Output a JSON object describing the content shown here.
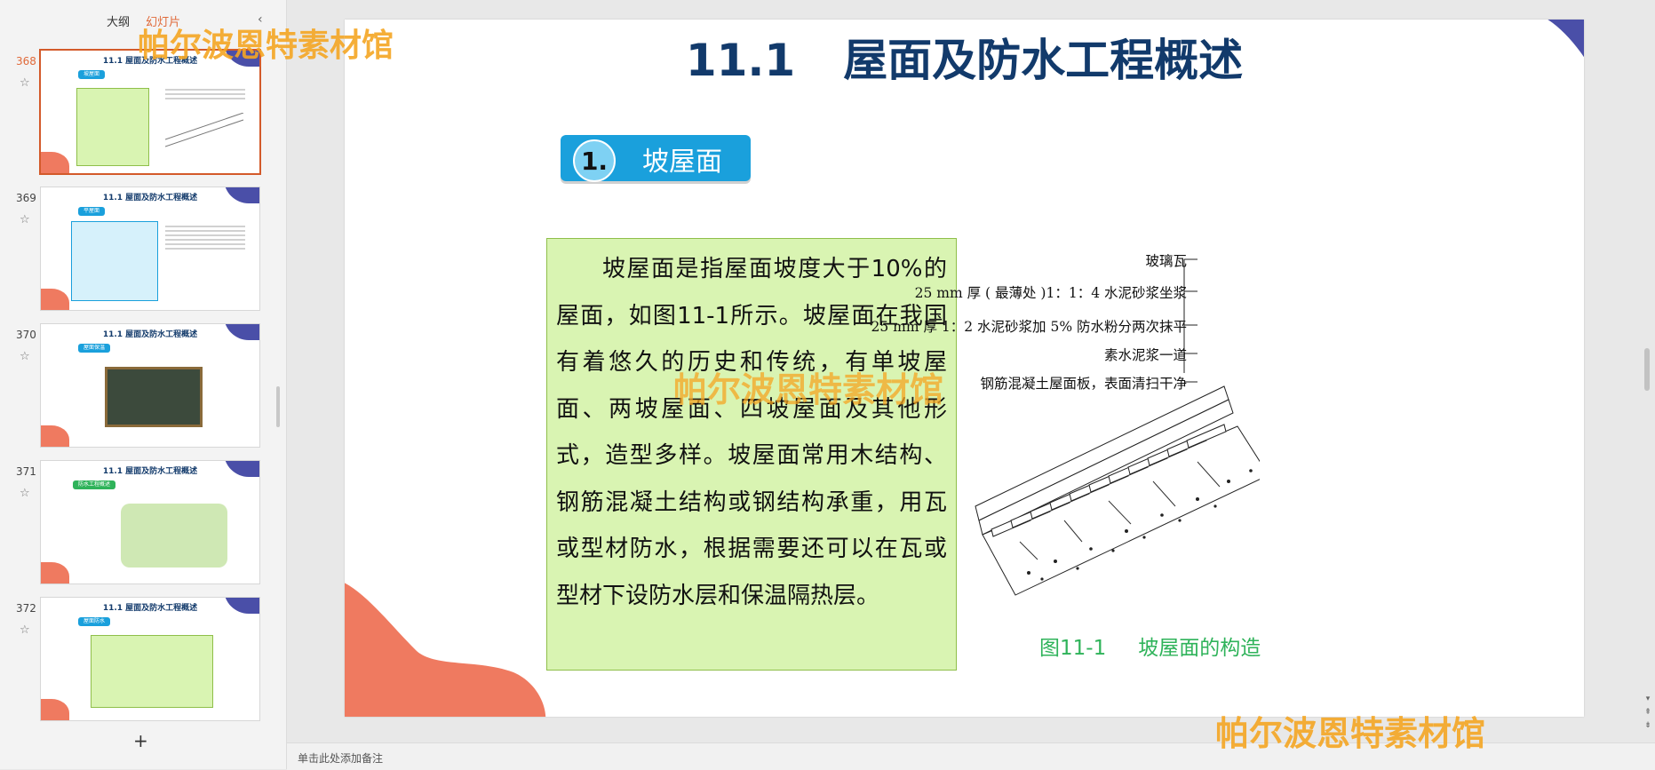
{
  "panel": {
    "tabs": [
      "大纲",
      "幻灯片"
    ],
    "active_tab": "幻灯片",
    "add_label": "+",
    "thumbnails": [
      {
        "num": "368",
        "title": "11.1    屋面及防水工程概述",
        "badge": "坡屋面"
      },
      {
        "num": "369",
        "title": "11.1    屋面及防水工程概述",
        "badge": "平屋面"
      },
      {
        "num": "370",
        "title": "11.1    屋面及防水工程概述",
        "badge": "屋面保温"
      },
      {
        "num": "371",
        "title": "11.1    屋面及防水工程概述",
        "badge": "防水工程概述"
      },
      {
        "num": "372",
        "title": "11.1    屋面及防水工程概述",
        "badge": "屋面防水"
      }
    ]
  },
  "slide": {
    "title_num": "11.1",
    "title_text": "屋面及防水工程概述",
    "section_number": "1.",
    "section_label": "坡屋面",
    "body": "坡屋面是指屋面坡度大于10%的屋面，如图11-1所示。坡屋面在我国有着悠久的历史和传统，有单坡屋面、两坡屋面、四坡屋面及其他形式，造型多样。坡屋面常用木结构、钢筋混凝土结构或钢结构承重，用瓦或型材防水，根据需要还可以在瓦或型材下设防水层和保温隔热层。",
    "figure_labels": [
      "玻璃瓦",
      "25 mm 厚 ( 最薄处 )1：1：4 水泥砂浆坐浆",
      "25 mm 厚 1：2 水泥砂浆加 5% 防水粉分两次抹平",
      "素水泥浆一道",
      "钢筋混凝土屋面板，表面清扫干净"
    ],
    "caption_num": "图11-1",
    "caption_text": "坡屋面的构造"
  },
  "notes_placeholder": "单击此处添加备注",
  "watermark": "帕尔波恩特素材馆",
  "colors": {
    "accent": "#e06a3a",
    "title": "#123a6b",
    "badge": "#1aa0dc",
    "caption": "#2fb35a",
    "blob_blue": "#4a4fa8",
    "blob_coral": "#ef7a60",
    "box_fill": "#d9f4b2"
  }
}
